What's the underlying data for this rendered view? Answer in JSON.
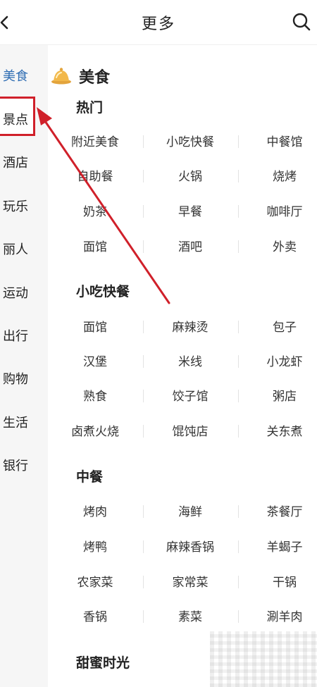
{
  "header": {
    "title": "更多",
    "back_icon": "chevron-left-icon",
    "search_icon": "search-icon"
  },
  "sidebar": {
    "active_index": 0,
    "items": [
      {
        "label": "美食"
      },
      {
        "label": "景点"
      },
      {
        "label": "酒店"
      },
      {
        "label": "玩乐"
      },
      {
        "label": "丽人"
      },
      {
        "label": "运动"
      },
      {
        "label": "出行"
      },
      {
        "label": "购物"
      },
      {
        "label": "生活"
      },
      {
        "label": "银行"
      }
    ]
  },
  "category": {
    "title": "美食",
    "icon": "food-dish-icon",
    "sections": [
      {
        "title": "热门",
        "items": [
          "附近美食",
          "小吃快餐",
          "中餐馆",
          "自助餐",
          "火锅",
          "烧烤",
          "奶茶",
          "早餐",
          "咖啡厅",
          "面馆",
          "酒吧",
          "外卖"
        ]
      },
      {
        "title": "小吃快餐",
        "items": [
          "面馆",
          "麻辣烫",
          "包子",
          "汉堡",
          "米线",
          "小龙虾",
          "熟食",
          "饺子馆",
          "粥店",
          "卤煮火烧",
          "馄饨店",
          "关东煮"
        ]
      },
      {
        "title": "中餐",
        "items": [
          "烤肉",
          "海鲜",
          "茶餐厅",
          "烤鸭",
          "麻辣香锅",
          "羊蝎子",
          "农家菜",
          "家常菜",
          "干锅",
          "香锅",
          "素菜",
          "涮羊肉"
        ]
      },
      {
        "title": "甜蜜时光",
        "items": []
      }
    ]
  },
  "colors": {
    "active_sidebar_text": "#2f6db3",
    "annotation_red": "#d0202a",
    "sidebar_bg": "#f6f6f6"
  }
}
